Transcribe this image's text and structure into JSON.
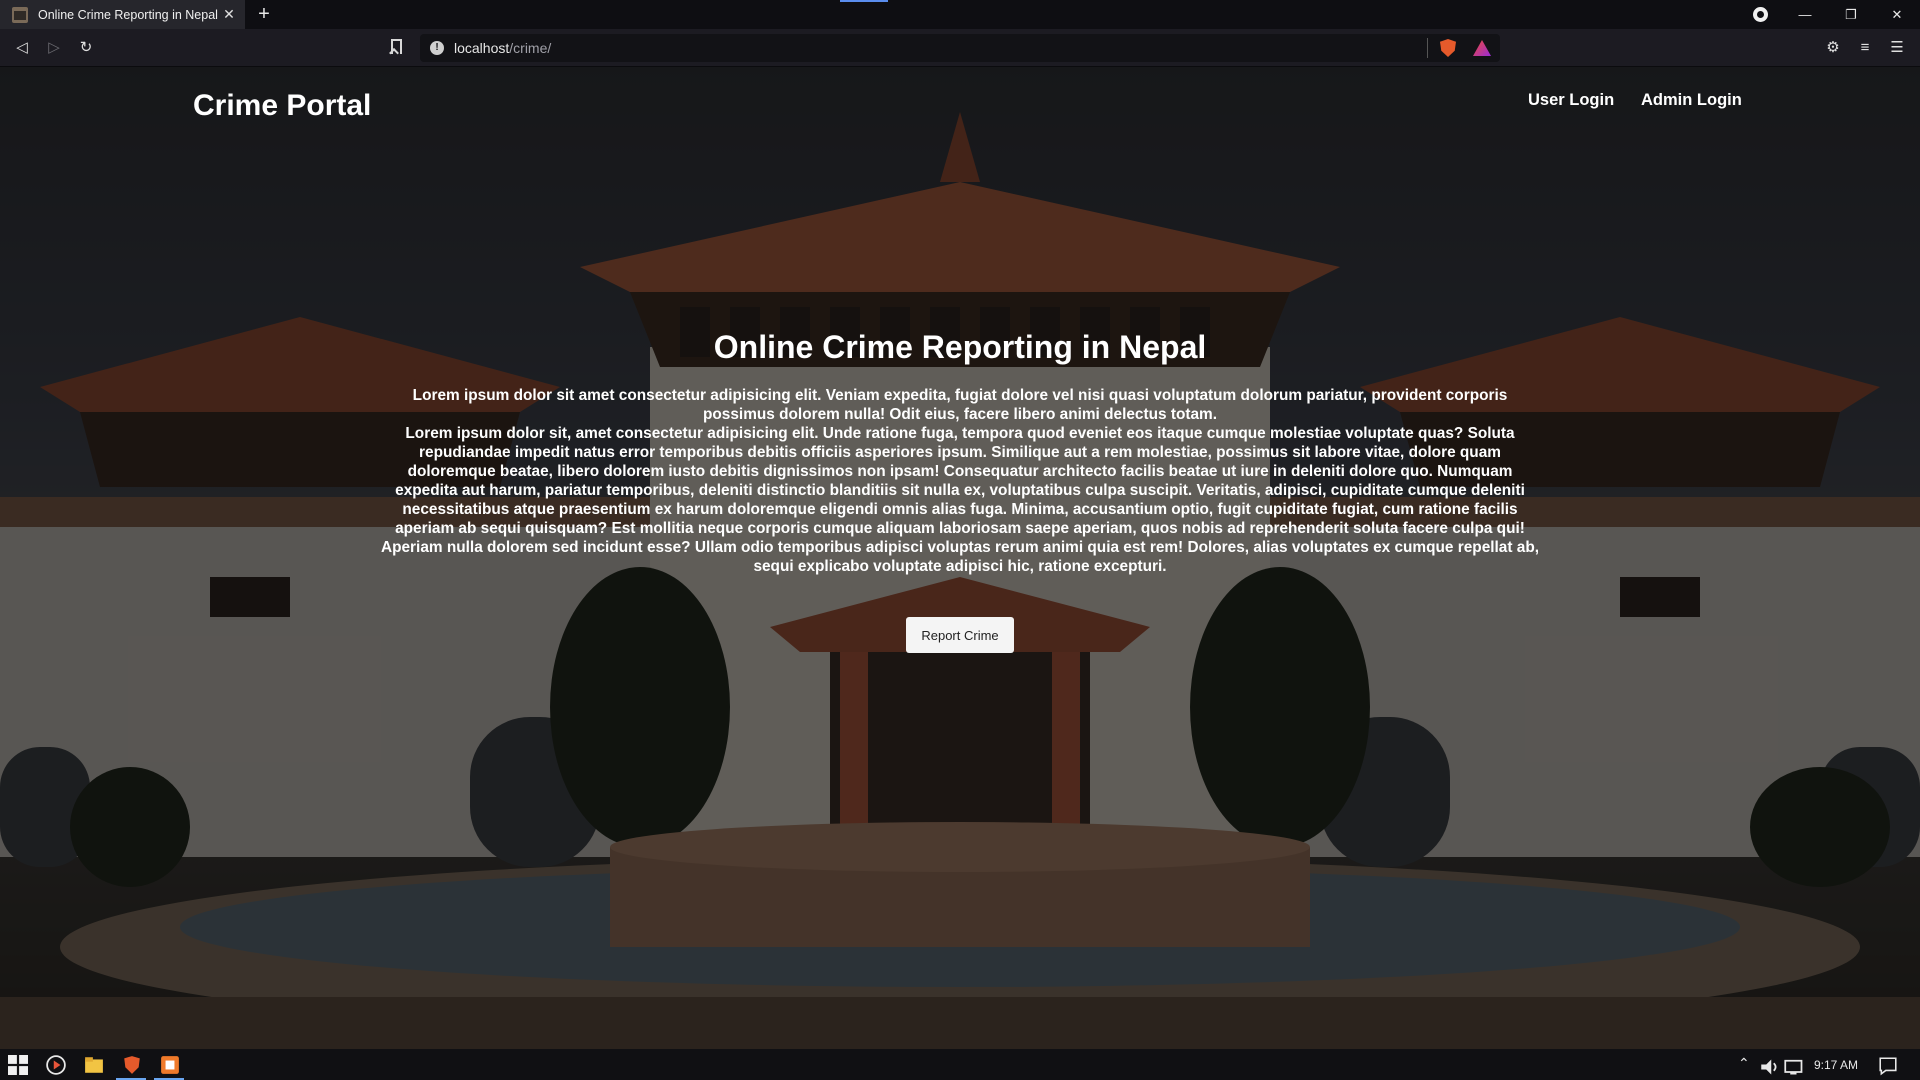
{
  "browser": {
    "tab_title": "Online Crime Reporting in Nepal",
    "tab_close": "✕",
    "new_tab": "+",
    "url_host": "localhost",
    "url_path": "/crime/",
    "back_glyph": "◁",
    "forward_glyph": "▷",
    "reload_glyph": "↻",
    "minimize_glyph": "—",
    "restore_glyph": "❐",
    "close_glyph": "✕"
  },
  "site": {
    "brand": "Crime Portal",
    "nav": [
      {
        "label": "User Login"
      },
      {
        "label": "Admin Login"
      }
    ]
  },
  "hero": {
    "title": "Online Crime Reporting in Nepal",
    "paragraph_1": "Lorem ipsum dolor sit amet consectetur adipisicing elit. Veniam expedita, fugiat dolore vel nisi quasi voluptatum dolorum pariatur, provident corporis possimus dolorem nulla! Odit eius, facere libero animi delectus totam.",
    "paragraph_2": "Lorem ipsum dolor sit, amet consectetur adipisicing elit. Unde ratione fuga, tempora quod eveniet eos itaque cumque molestiae voluptate quas? Soluta repudiandae impedit natus error temporibus debitis officiis asperiores ipsum. Similique aut a rem molestiae, possimus sit labore vitae, dolore quam doloremque beatae, libero dolorem iusto debitis dignissimos non ipsam! Consequatur architecto facilis beatae ut iure in deleniti dolore quo. Numquam expedita aut harum, pariatur temporibus, deleniti distinctio blanditiis sit nulla ex, voluptatibus culpa suscipit. Veritatis, adipisci, cupiditate cumque deleniti necessitatibus atque praesentium ex harum doloremque eligendi omnis alias fuga. Minima, accusantium optio, fugit cupiditate fugiat, cum ratione facilis aperiam ab sequi quisquam? Est mollitia neque corporis cumque aliquam laboriosam saepe aperiam, quos nobis ad reprehenderit soluta facere culpa qui! Aperiam nulla dolorem sed incidunt esse? Ullam odio temporibus adipisci voluptas rerum animi quia est rem! Dolores, alias voluptates ex cumque repellat ab, sequi explicabo voluptate adipisci hic, ratione excepturi.",
    "button": "Report Crime"
  },
  "taskbar": {
    "time": "9:17 AM"
  }
}
